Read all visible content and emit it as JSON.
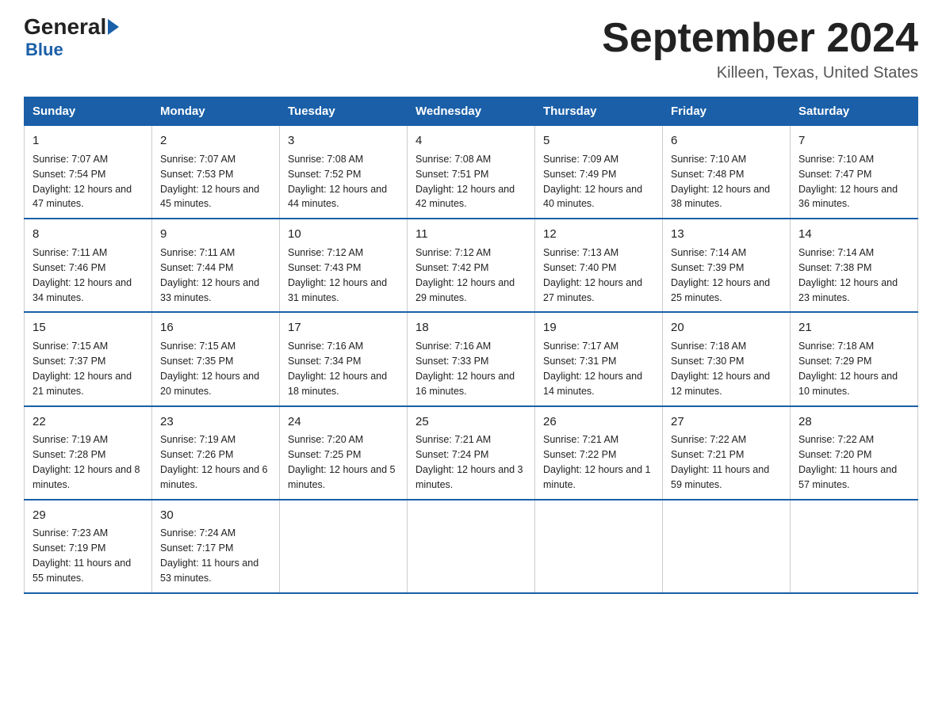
{
  "header": {
    "logo_general": "General",
    "logo_blue": "Blue",
    "title": "September 2024",
    "location": "Killeen, Texas, United States"
  },
  "days_of_week": [
    "Sunday",
    "Monday",
    "Tuesday",
    "Wednesday",
    "Thursday",
    "Friday",
    "Saturday"
  ],
  "weeks": [
    [
      {
        "day": "1",
        "sunrise": "7:07 AM",
        "sunset": "7:54 PM",
        "daylight": "12 hours and 47 minutes."
      },
      {
        "day": "2",
        "sunrise": "7:07 AM",
        "sunset": "7:53 PM",
        "daylight": "12 hours and 45 minutes."
      },
      {
        "day": "3",
        "sunrise": "7:08 AM",
        "sunset": "7:52 PM",
        "daylight": "12 hours and 44 minutes."
      },
      {
        "day": "4",
        "sunrise": "7:08 AM",
        "sunset": "7:51 PM",
        "daylight": "12 hours and 42 minutes."
      },
      {
        "day": "5",
        "sunrise": "7:09 AM",
        "sunset": "7:49 PM",
        "daylight": "12 hours and 40 minutes."
      },
      {
        "day": "6",
        "sunrise": "7:10 AM",
        "sunset": "7:48 PM",
        "daylight": "12 hours and 38 minutes."
      },
      {
        "day": "7",
        "sunrise": "7:10 AM",
        "sunset": "7:47 PM",
        "daylight": "12 hours and 36 minutes."
      }
    ],
    [
      {
        "day": "8",
        "sunrise": "7:11 AM",
        "sunset": "7:46 PM",
        "daylight": "12 hours and 34 minutes."
      },
      {
        "day": "9",
        "sunrise": "7:11 AM",
        "sunset": "7:44 PM",
        "daylight": "12 hours and 33 minutes."
      },
      {
        "day": "10",
        "sunrise": "7:12 AM",
        "sunset": "7:43 PM",
        "daylight": "12 hours and 31 minutes."
      },
      {
        "day": "11",
        "sunrise": "7:12 AM",
        "sunset": "7:42 PM",
        "daylight": "12 hours and 29 minutes."
      },
      {
        "day": "12",
        "sunrise": "7:13 AM",
        "sunset": "7:40 PM",
        "daylight": "12 hours and 27 minutes."
      },
      {
        "day": "13",
        "sunrise": "7:14 AM",
        "sunset": "7:39 PM",
        "daylight": "12 hours and 25 minutes."
      },
      {
        "day": "14",
        "sunrise": "7:14 AM",
        "sunset": "7:38 PM",
        "daylight": "12 hours and 23 minutes."
      }
    ],
    [
      {
        "day": "15",
        "sunrise": "7:15 AM",
        "sunset": "7:37 PM",
        "daylight": "12 hours and 21 minutes."
      },
      {
        "day": "16",
        "sunrise": "7:15 AM",
        "sunset": "7:35 PM",
        "daylight": "12 hours and 20 minutes."
      },
      {
        "day": "17",
        "sunrise": "7:16 AM",
        "sunset": "7:34 PM",
        "daylight": "12 hours and 18 minutes."
      },
      {
        "day": "18",
        "sunrise": "7:16 AM",
        "sunset": "7:33 PM",
        "daylight": "12 hours and 16 minutes."
      },
      {
        "day": "19",
        "sunrise": "7:17 AM",
        "sunset": "7:31 PM",
        "daylight": "12 hours and 14 minutes."
      },
      {
        "day": "20",
        "sunrise": "7:18 AM",
        "sunset": "7:30 PM",
        "daylight": "12 hours and 12 minutes."
      },
      {
        "day": "21",
        "sunrise": "7:18 AM",
        "sunset": "7:29 PM",
        "daylight": "12 hours and 10 minutes."
      }
    ],
    [
      {
        "day": "22",
        "sunrise": "7:19 AM",
        "sunset": "7:28 PM",
        "daylight": "12 hours and 8 minutes."
      },
      {
        "day": "23",
        "sunrise": "7:19 AM",
        "sunset": "7:26 PM",
        "daylight": "12 hours and 6 minutes."
      },
      {
        "day": "24",
        "sunrise": "7:20 AM",
        "sunset": "7:25 PM",
        "daylight": "12 hours and 5 minutes."
      },
      {
        "day": "25",
        "sunrise": "7:21 AM",
        "sunset": "7:24 PM",
        "daylight": "12 hours and 3 minutes."
      },
      {
        "day": "26",
        "sunrise": "7:21 AM",
        "sunset": "7:22 PM",
        "daylight": "12 hours and 1 minute."
      },
      {
        "day": "27",
        "sunrise": "7:22 AM",
        "sunset": "7:21 PM",
        "daylight": "11 hours and 59 minutes."
      },
      {
        "day": "28",
        "sunrise": "7:22 AM",
        "sunset": "7:20 PM",
        "daylight": "11 hours and 57 minutes."
      }
    ],
    [
      {
        "day": "29",
        "sunrise": "7:23 AM",
        "sunset": "7:19 PM",
        "daylight": "11 hours and 55 minutes."
      },
      {
        "day": "30",
        "sunrise": "7:24 AM",
        "sunset": "7:17 PM",
        "daylight": "11 hours and 53 minutes."
      },
      null,
      null,
      null,
      null,
      null
    ]
  ]
}
